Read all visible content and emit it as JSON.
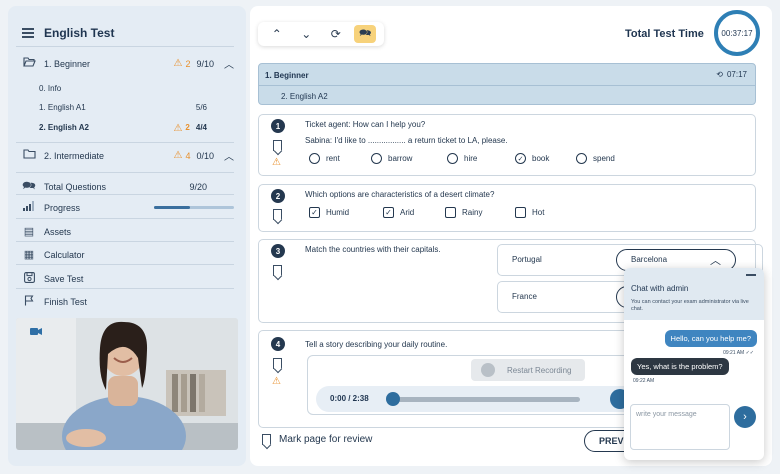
{
  "sidebar": {
    "title": "English Test",
    "sections": [
      {
        "label": "1. Beginner",
        "warn_count": "2",
        "progress": "9/10",
        "icon": "folder-open-icon"
      },
      {
        "label": "2. Intermediate",
        "warn_count": "4",
        "progress": "0/10",
        "icon": "folder-icon"
      }
    ],
    "subitems": [
      {
        "label": "0. Info",
        "count": ""
      },
      {
        "label": "1. English A1",
        "count": "5/6"
      },
      {
        "label": "2. English A2",
        "warn_count": "2",
        "count": "4/4"
      }
    ],
    "total_questions_label": "Total Questions",
    "total_questions_value": "9/20",
    "progress_label": "Progress",
    "progress_fraction": 0.45,
    "menu": [
      {
        "label": "Assets",
        "icon": "assets-icon"
      },
      {
        "label": "Calculator",
        "icon": "calculator-icon"
      },
      {
        "label": "Save Test",
        "icon": "save-icon"
      },
      {
        "label": "Finish Test",
        "icon": "flag-icon"
      }
    ]
  },
  "header": {
    "total_time_label": "Total Test Time",
    "timer": "00:37:17"
  },
  "section": {
    "title": "1.  Beginner",
    "time": "07:17",
    "subsection": "2.  English A2"
  },
  "questions": [
    {
      "num": "1",
      "line1": "Ticket agent: How can I help you?",
      "line2": "Sabina: I'd like to ................. a return ticket to LA, please.",
      "options": [
        "rent",
        "barrow",
        "hire",
        "book",
        "spend"
      ]
    },
    {
      "num": "2",
      "text": "Which options are characteristics of a desert climate?",
      "options": [
        "Humid",
        "Arid",
        "Rainy",
        "Hot"
      ]
    },
    {
      "num": "3",
      "text": "Match the countries with their capitals.",
      "pairs": [
        {
          "country": "Portugal",
          "selected": "Barcelona"
        },
        {
          "country": "France",
          "selected": ""
        }
      ]
    },
    {
      "num": "4",
      "text": "Tell a story describing your daily routine.",
      "record_label": "Restart Recording",
      "time": "0:00 / 2:38"
    }
  ],
  "footer": {
    "mark_review": "Mark page for review",
    "prev": "PREV"
  },
  "chat": {
    "title": "Chat with admin",
    "subtitle": "You can contact your exam administrator via live chat.",
    "msg_out": "Hello, can you help me?",
    "msg_out_time": "09:21 AM",
    "msg_in": "Yes, what is the problem?",
    "msg_in_time": "09:22 AM",
    "placeholder": "write your message"
  }
}
